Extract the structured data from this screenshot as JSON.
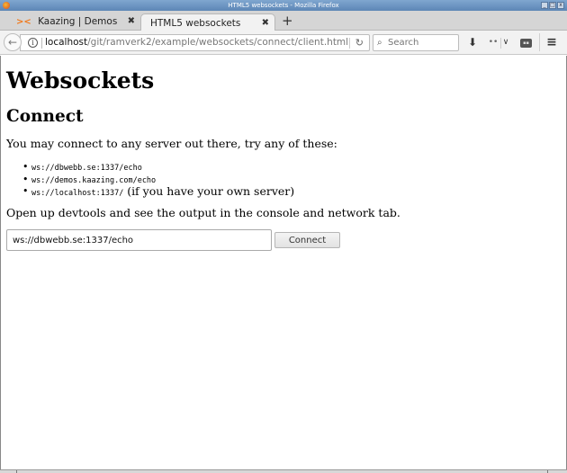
{
  "window": {
    "title": "HTML5 websockets - Mozilla Firefox",
    "controls": [
      "minimize",
      "maximize",
      "close"
    ]
  },
  "tabs": [
    {
      "label": "Kaazing | Demos",
      "icon": "kaazing-logo-icon",
      "icon_glyph": "><",
      "active": false
    },
    {
      "label": "HTML5 websockets",
      "active": true
    }
  ],
  "tab_close_glyph": "✖",
  "new_tab_glyph": "+",
  "navbar": {
    "back_glyph": "←",
    "url_host": "localhost",
    "url_path": "/git/ramverk2/example/websockets/connect/client.html",
    "reload_glyph": "↻",
    "search_placeholder": "Search",
    "search_glyph": "⌕",
    "download_glyph": "⬇",
    "extension_glyph": "••",
    "chevron_glyph": "∨",
    "reader_glyph": "≡",
    "menu_glyph": "≡"
  },
  "page": {
    "heading": "Websockets",
    "subheading": "Connect",
    "intro": "You may connect to any server out there, try any of these:",
    "servers": [
      {
        "url": "ws://dbwebb.se:1337/echo",
        "note": ""
      },
      {
        "url": "ws://demos.kaazing.com/echo",
        "note": ""
      },
      {
        "url": "ws://localhost:1337/",
        "note": "(if you have your own server)"
      }
    ],
    "devtools_hint": "Open up devtools and see the output in the console and network tab.",
    "url_input_value": "ws://dbwebb.se:1337/echo",
    "connect_label": "Connect"
  },
  "colors": {
    "titlebar": "#5d86b6",
    "kaazing_accent": "#f07a1e"
  }
}
